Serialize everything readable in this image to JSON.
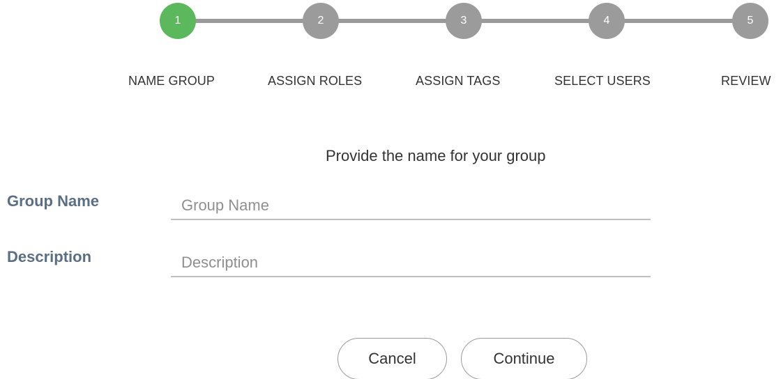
{
  "stepper": {
    "active_color": "#5cb85c",
    "inactive_color": "#9b9b9b",
    "steps": [
      {
        "number": "1",
        "label": "NAME GROUP",
        "state": "active"
      },
      {
        "number": "2",
        "label": "ASSIGN ROLES",
        "state": "inactive"
      },
      {
        "number": "3",
        "label": "ASSIGN TAGS",
        "state": "inactive"
      },
      {
        "number": "4",
        "label": "SELECT USERS",
        "state": "inactive"
      },
      {
        "number": "5",
        "label": "REVIEW",
        "state": "inactive"
      }
    ]
  },
  "form": {
    "prompt": "Provide the name for your group",
    "group_name": {
      "label": "Group Name",
      "value": "",
      "placeholder": "Group Name"
    },
    "description": {
      "label": "Description",
      "value": "",
      "placeholder": "Description"
    }
  },
  "actions": {
    "cancel_label": "Cancel",
    "continue_label": "Continue"
  }
}
